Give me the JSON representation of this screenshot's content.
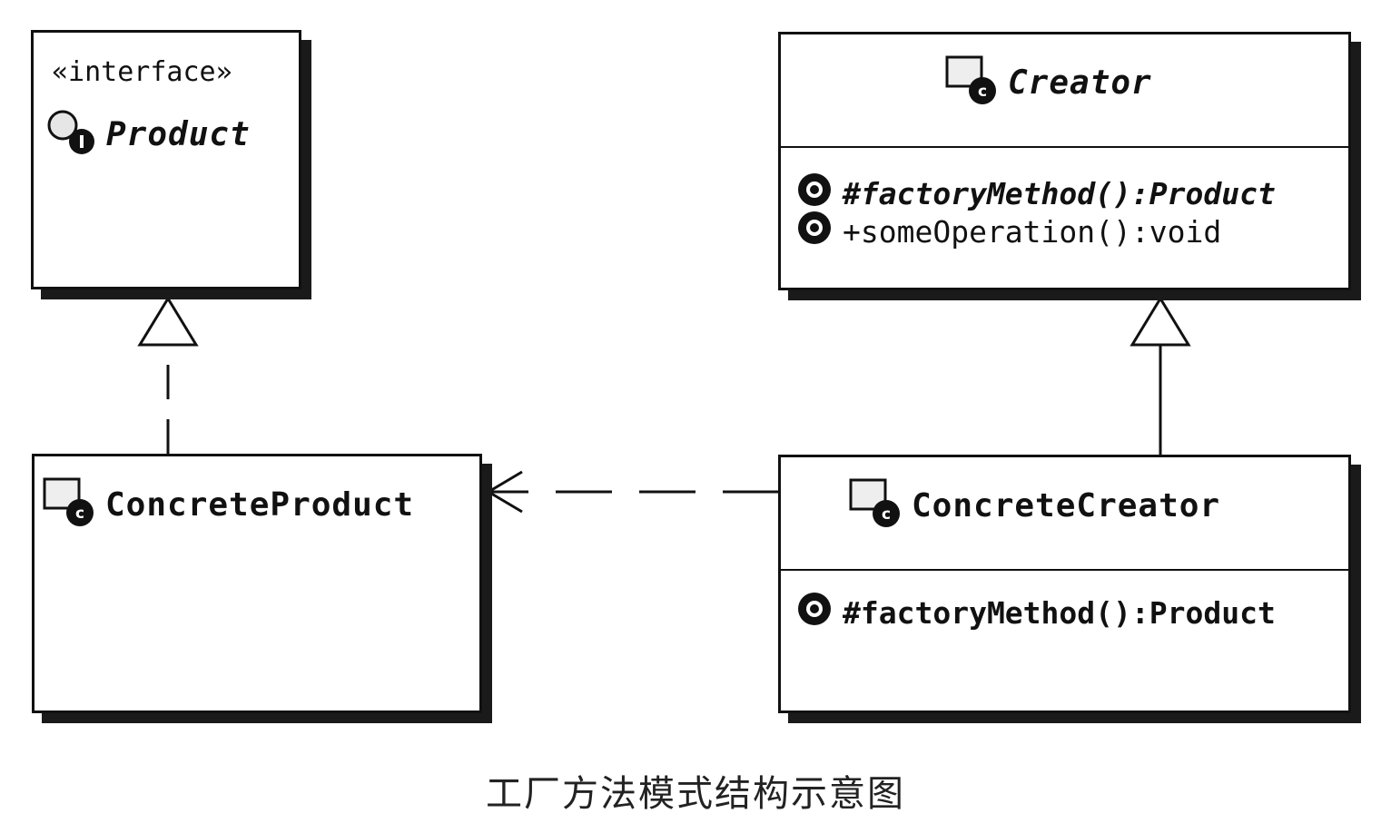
{
  "classes": {
    "product": {
      "stereotype": "«interface»",
      "name": "Product"
    },
    "creator": {
      "name": "Creator",
      "operations": [
        "#factoryMethod():Product",
        "+someOperation():void"
      ]
    },
    "concrete_product": {
      "name": "ConcreteProduct"
    },
    "concrete_creator": {
      "name": "ConcreteCreator",
      "operations": [
        "#factoryMethod():Product"
      ]
    }
  },
  "caption": "工厂方法模式结构示意图",
  "colors": {
    "line": "#111111",
    "shadow": "#1a1a1a",
    "background": "#ffffff"
  },
  "icons": {
    "interface": "interface-icon",
    "class": "class-icon",
    "operation": "operation-icon"
  }
}
